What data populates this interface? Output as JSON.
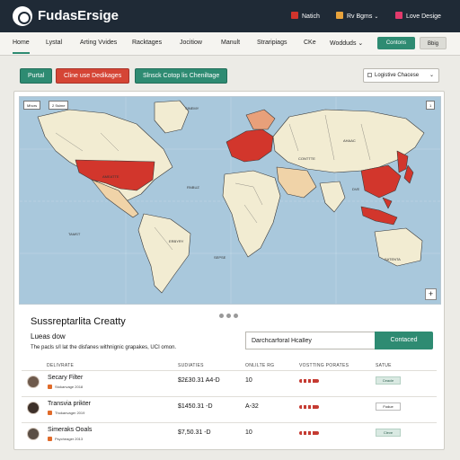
{
  "header": {
    "brand": "FudasErsige",
    "links": [
      {
        "label": "Natich",
        "badge_color": "#d0342c"
      },
      {
        "label": "Rv Bgms",
        "badge_color": "#e8a33c"
      },
      {
        "label": "Love Desige",
        "badge_color": "#e23a6c"
      }
    ]
  },
  "nav": {
    "items": [
      "Home",
      "Lystal",
      "Arting Vvides",
      "Racktages",
      "Jocitiow",
      "Manult",
      "Straripiags",
      "CKe",
      "Wodduds"
    ],
    "caret": "⌄",
    "primary_button": "Contons",
    "secondary_button": "Bbig"
  },
  "filters": {
    "chips": [
      {
        "label": "Purtal",
        "bg": "#2e8b72",
        "fg": "#ffffff"
      },
      {
        "label": "Cline use Dedikages",
        "bg": "#d54535",
        "fg": "#ffffff"
      },
      {
        "label": "Slnsck Cotop lis Cheniltage",
        "bg": "#2e8b72",
        "fg": "#ffffff"
      }
    ],
    "select": {
      "value": "Logistive Chacese",
      "caret": "⌄"
    }
  },
  "map": {
    "tags": [
      "Mhors",
      "2 Ssime"
    ],
    "tag_right": "1",
    "labels": [
      "SINEMY",
      "Ameatte",
      "Ahaac",
      "Conttte",
      "Rnbuz",
      "Tamst",
      "Erbyry",
      "Sepse",
      "Dve",
      "Satenta"
    ],
    "red_color": "#d2362c",
    "zoom_in": "+"
  },
  "section": {
    "title": "Sussreptarlita Creatty",
    "subtitle": "Lueas dow",
    "description": "The pacls s/l lat the disfanes withnignic grapakes, UCI omon."
  },
  "search": {
    "value": "Darchcarforal Hcalley",
    "button": "Contaced"
  },
  "table": {
    "headers": [
      "DELIVRATE",
      "SUDIATIES",
      "ONLILTE RG",
      "VOSTTING PORATES",
      "SATUE"
    ],
    "rows": [
      {
        "name": "Secary Filter",
        "meta": "Stokanvage 2018",
        "price": "$2£30.31 A4-D",
        "count": "10",
        "status": "Ceacle",
        "status_style": "green"
      },
      {
        "name": "Transvia prikter",
        "meta": "Thokanvager 2019",
        "price": "$1450.31 -D",
        "count": "A-32",
        "status": "Fodue",
        "status_style": "white"
      },
      {
        "name": "Simeraks Ooals",
        "meta": "Psycheager 2013",
        "price": "$7,50.31 -D",
        "count": "10",
        "status": "Cleve",
        "status_style": "green"
      }
    ]
  }
}
